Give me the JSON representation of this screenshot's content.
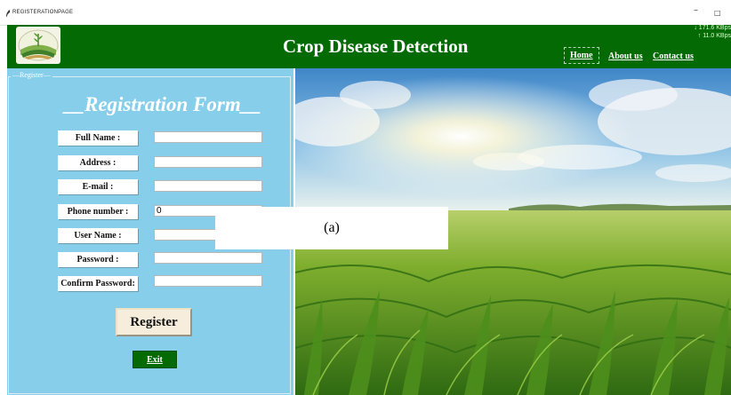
{
  "window": {
    "title": "REGISTERATIONPAGE",
    "minimize_glyph": "–",
    "maximize_glyph": "□"
  },
  "header": {
    "title": "Crop Disease Detection",
    "nav": [
      "Home",
      "About us",
      "Contact us"
    ],
    "net_speed": {
      "down": "↓ 171.6 KBps",
      "up": "↑ 11.0 KBps"
    },
    "bg_color": "#046b04"
  },
  "panel": {
    "legend": "Register",
    "form_title": "__Registration Form__",
    "bg_color": "#87ceea",
    "fields": [
      {
        "label": "Full Name :",
        "value": ""
      },
      {
        "label": "Address :",
        "value": ""
      },
      {
        "label": "E-mail :",
        "value": ""
      },
      {
        "label": "Phone number :",
        "value": "0"
      },
      {
        "label": "User Name :",
        "value": ""
      },
      {
        "label": "Password :",
        "value": ""
      },
      {
        "label": "Confirm Password:",
        "value": ""
      }
    ],
    "register_label": "Register",
    "exit_label": "Exit"
  },
  "caption": "(a)",
  "icons": {
    "app": "feather-icon",
    "logo": "crop-field-logo-icon"
  }
}
